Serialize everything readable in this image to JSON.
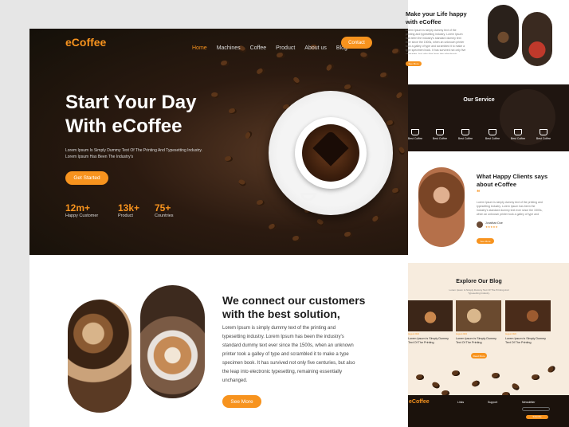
{
  "nav": {
    "brand": "eCoffee",
    "items": [
      "Home",
      "Machines",
      "Coffee",
      "Product",
      "About us",
      "Blog"
    ],
    "contact": "Contact"
  },
  "hero": {
    "title_line1": "Start Your Day",
    "title_line2": "With eCoffee",
    "subtitle_line1": "Lorem Ipsum Is Simply Dummy Text Of The Printing And Typesetting Industry.",
    "subtitle_line2": "Lorem Ipsum Has Been The Industry's",
    "cta": "Get Started",
    "stats": [
      {
        "value": "12m+",
        "label": "Happy Customer"
      },
      {
        "value": "13k+",
        "label": "Product"
      },
      {
        "value": "75+",
        "label": "Countries"
      }
    ]
  },
  "connect": {
    "title_line1": "We connect our customers",
    "title_line2": "with the best solution,",
    "body": "Lorem Ipsum is simply dummy text of the printing and typesetting industry. Lorem Ipsum has been the industry's standard dummy text ever since the 1500s, when an unknown printer took a galley of type and scrambled it to make a type specimen book. It has survived not only five centuries, but also the leap into electronic typesetting, remaining essentially unchanged.",
    "cta": "See More"
  },
  "right": {
    "life": {
      "title_line1": "Make your Life happy",
      "title_line2": "with eCoffee",
      "body": "Lorem Ipsum is simply dummy text of the printing and typesetting industry. Lorem Ipsum has been the industry's standard dummy text ever since the 1500s, when an unknown printer took a galley of type and scrambled it to make a type specimen book. It has survived not only five centuries, but also the leap into electronic typesetting, remaining essentially unchanged.",
      "cta": "See More"
    },
    "service": {
      "title": "Our Service",
      "items": [
        "Best Coffee",
        "Best Coffee",
        "Best Coffee",
        "Best Coffee",
        "Best Coffee",
        "Best Coffee"
      ]
    },
    "clients": {
      "title_line1": "What Happy Clients says",
      "title_line2": "about eCoffee",
      "quote_mark": "❝",
      "body": "Lorem Ipsum is simply dummy text of the printing and typesetting industry. Lorem Ipsum has been the industry's standard dummy text ever since the 1500s, when an unknown printer took a galley of type and scrambled it to make a type specimen book.",
      "name": "Jonathan Doe",
      "stars": "★★★★★",
      "cta": "See More"
    },
    "blog": {
      "title": "Explore Our Blog",
      "subtitle_line1": "Lorem Ipsum Is Simply Dummy Text Of The Printing And",
      "subtitle_line2": "Typesetting Industry.",
      "posts": [
        {
          "date": "August 2022",
          "title_line1": "Lorem Ipsum is Simply Dummy",
          "title_line2": "Text Of The Printing"
        },
        {
          "date": "August 2022",
          "title_line1": "Lorem Ipsum is Simply Dummy",
          "title_line2": "Text Of The Printing"
        },
        {
          "date": "August 2022",
          "title_line1": "Lorem Ipsum is Simply Dummy",
          "title_line2": "Text Of The Printing"
        }
      ],
      "cta": "Read More"
    },
    "footer": {
      "brand": "eCoffee",
      "col1": "Links",
      "col2": "Support",
      "col3": "Newsletter",
      "subscribe": "Subscribe"
    }
  },
  "colors": {
    "accent": "#f7931e",
    "dark": "#1b120c",
    "light_bg": "#f7ecde"
  }
}
